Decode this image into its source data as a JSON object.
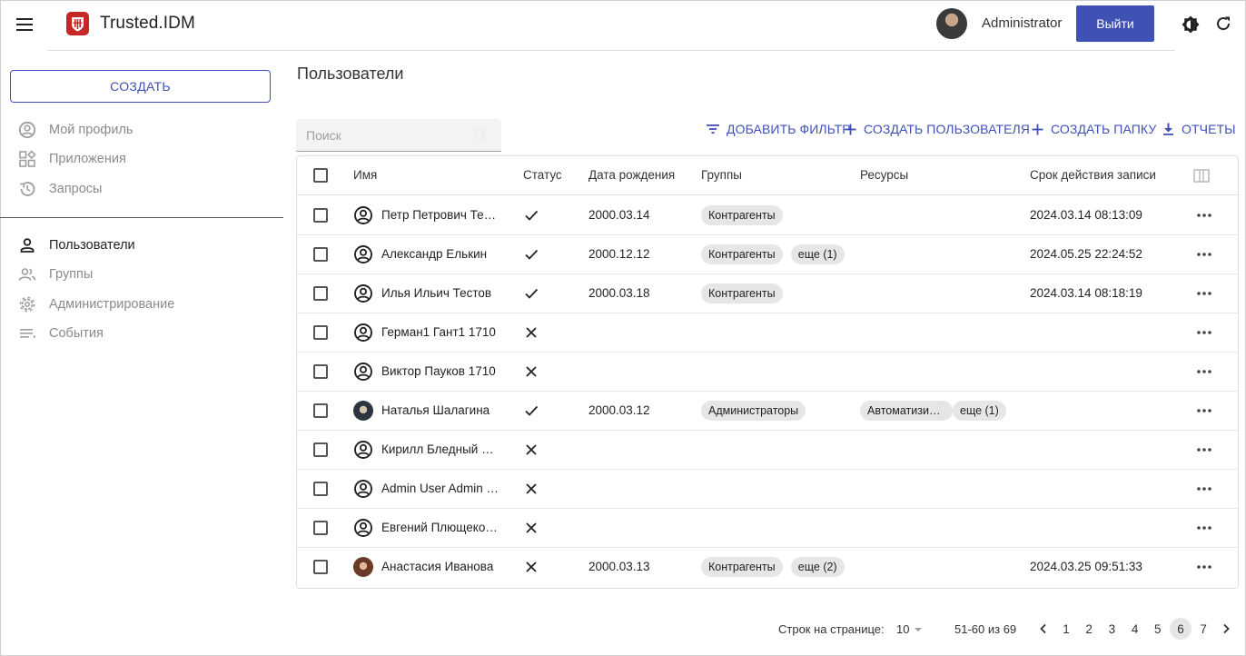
{
  "header": {
    "app_title": "Trusted.IDM",
    "user_name": "Administrator",
    "logout_label": "Выйти"
  },
  "sidebar": {
    "create_label": "СОЗДАТЬ",
    "items_top": [
      {
        "label": "Мой профиль",
        "icon": "account-circle-icon"
      },
      {
        "label": "Приложения",
        "icon": "apps-icon"
      },
      {
        "label": "Запросы",
        "icon": "history-icon"
      }
    ],
    "items_bottom": [
      {
        "label": "Пользователи",
        "icon": "person-icon",
        "active": true
      },
      {
        "label": "Группы",
        "icon": "people-icon"
      },
      {
        "label": "Администрирование",
        "icon": "gear-icon"
      },
      {
        "label": "События",
        "icon": "list-icon"
      }
    ]
  },
  "main": {
    "title": "Пользователи",
    "search_placeholder": "Поиск",
    "actions": {
      "add_filter": "ДОБАВИТЬ ФИЛЬТР",
      "create_user": "СОЗДАТЬ ПОЛЬЗОВАТЕЛЯ",
      "create_folder": "СОЗДАТЬ ПАПКУ",
      "reports": "ОТЧЕТЫ"
    }
  },
  "table": {
    "columns": {
      "name": "Имя",
      "status": "Статус",
      "birth": "Дата рождения",
      "groups": "Группы",
      "resources": "Ресурсы",
      "expiry": "Срок действия записи"
    },
    "rows": [
      {
        "name": "Петр Петрович Тестов",
        "avatar": "default",
        "status": "active",
        "birth": "2000.03.14",
        "groups": [
          "Контрагенты"
        ],
        "resources": [],
        "expiry": "2024.03.14 08:13:09"
      },
      {
        "name": "Александр Елькин",
        "avatar": "default",
        "status": "active",
        "birth": "2000.12.12",
        "groups": [
          "Контрагенты",
          "еще (1)"
        ],
        "resources": [],
        "expiry": "2024.05.25 22:24:52"
      },
      {
        "name": "Илья Ильич Тестов",
        "avatar": "default",
        "status": "active",
        "birth": "2000.03.18",
        "groups": [
          "Контрагенты"
        ],
        "resources": [],
        "expiry": "2024.03.14 08:18:19"
      },
      {
        "name": "Герман1 Гант1 1710",
        "avatar": "default",
        "status": "inactive",
        "birth": "",
        "groups": [],
        "resources": [],
        "expiry": ""
      },
      {
        "name": "Виктор Пауков 1710",
        "avatar": "default",
        "status": "inactive",
        "birth": "",
        "groups": [],
        "resources": [],
        "expiry": ""
      },
      {
        "name": "Наталья Шалагина",
        "avatar": "photo-dark",
        "status": "active",
        "birth": "2000.03.12",
        "groups": [
          "Администраторы"
        ],
        "resources": [
          "Автоматизированная",
          "еще (1)"
        ],
        "expiry": ""
      },
      {
        "name": "Кирилл Бледный Кириллович",
        "avatar": "default",
        "status": "inactive",
        "birth": "",
        "groups": [],
        "resources": [],
        "expiry": ""
      },
      {
        "name": "Admin User Admin User",
        "avatar": "default",
        "status": "inactive",
        "birth": "",
        "groups": [],
        "resources": [],
        "expiry": ""
      },
      {
        "name": "Евгений Плющеко Евгеньевич",
        "avatar": "default",
        "status": "inactive",
        "birth": "",
        "groups": [],
        "resources": [],
        "expiry": ""
      },
      {
        "name": "Анастасия Иванова",
        "avatar": "photo-warm",
        "status": "inactive",
        "birth": "2000.03.13",
        "groups": [
          "Контрагенты",
          "еще (2)"
        ],
        "resources": [],
        "expiry": "2024.03.25 09:51:33"
      }
    ]
  },
  "pagination": {
    "rows_per_page_label": "Строк на странице:",
    "rows_per_page": "10",
    "range": "51-60 из 69",
    "pages": [
      "1",
      "2",
      "3",
      "4",
      "5",
      "6",
      "7"
    ],
    "current_page": "6"
  },
  "colors": {
    "accent": "#3f51b5",
    "logo": "#c62828",
    "chip": "#e6e6e6"
  }
}
